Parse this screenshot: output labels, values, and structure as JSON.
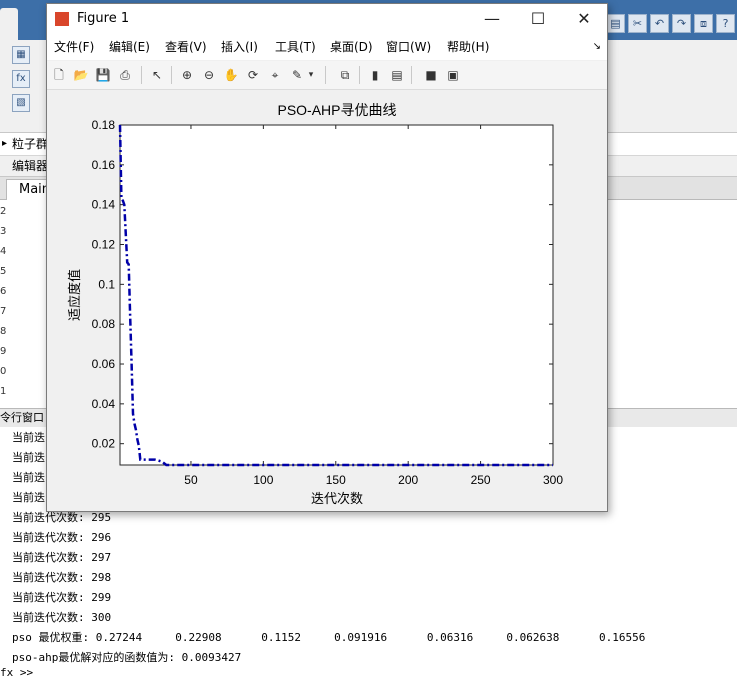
{
  "figure": {
    "title": "Figure 1",
    "controls": {
      "minimize": "—",
      "maximize": "☐",
      "close": "✕"
    },
    "menus": [
      "文件(F)",
      "编辑(E)",
      "查看(V)",
      "插入(I)",
      "工具(T)",
      "桌面(D)",
      "窗口(W)",
      "帮助(H)"
    ],
    "toolbar_icons": [
      "new-figure-icon",
      "open-file-icon",
      "save-icon",
      "print-icon",
      "pointer-icon",
      "zoom-in-icon",
      "zoom-out-icon",
      "pan-icon",
      "rotate-icon",
      "data-cursor-icon",
      "brush-icon",
      "link-plot-icon",
      "colorbar-icon",
      "legend-icon",
      "hide-plot-tools-icon",
      "show-plot-tools-icon"
    ]
  },
  "chart_data": {
    "type": "line",
    "title": "PSO-AHP寻优曲线",
    "xlabel": "迭代次数",
    "ylabel": "适应度值",
    "xlim": [
      1,
      300
    ],
    "ylim": [
      0.0093,
      0.18
    ],
    "xticks": [
      50,
      100,
      150,
      200,
      250,
      300
    ],
    "yticks": [
      0.02,
      0.04,
      0.06,
      0.08,
      0.1,
      0.12,
      0.14,
      0.16,
      0.18
    ],
    "grid": false,
    "series": [
      {
        "color": "#0000a8",
        "style": "dash-dot",
        "x": [
          1,
          2,
          3,
          4,
          5,
          6,
          7,
          8,
          9,
          10,
          11,
          12,
          13,
          14,
          15,
          16,
          17,
          20,
          25,
          30,
          33,
          35,
          40,
          60,
          100,
          150,
          200,
          250,
          300
        ],
        "y": [
          0.18,
          0.143,
          0.142,
          0.14,
          0.125,
          0.111,
          0.11,
          0.085,
          0.06,
          0.035,
          0.03,
          0.027,
          0.022,
          0.019,
          0.012,
          0.012,
          0.012,
          0.012,
          0.012,
          0.011,
          0.0093,
          0.0093,
          0.0093,
          0.0093,
          0.0093,
          0.0093,
          0.0093,
          0.0093,
          0.0093
        ]
      }
    ]
  },
  "background": {
    "path_label": "粒子群",
    "editor_label": "编辑器",
    "editor_tab": "Main",
    "line_numbers": [
      "2",
      "3",
      "4",
      "5",
      "6",
      "7",
      "8",
      "9",
      "0",
      "1"
    ],
    "command_window_label": "令行窗口",
    "partial_lines": [
      "当前迭",
      "当前迭",
      "当前迭",
      "当前迭"
    ],
    "iteration_lines": [
      "当前迭代次数: 295",
      "当前迭代次数: 296",
      "当前迭代次数: 297",
      "当前迭代次数: 298",
      "当前迭代次数: 299",
      "当前迭代次数: 300"
    ],
    "weights_line": "pso 最优权重: 0.27244     0.22908      0.1152     0.091916      0.06316     0.062638      0.16556",
    "result_line": "pso-ahp最优解对应的函数值为: 0.0093427",
    "prompt": "fx >>"
  }
}
